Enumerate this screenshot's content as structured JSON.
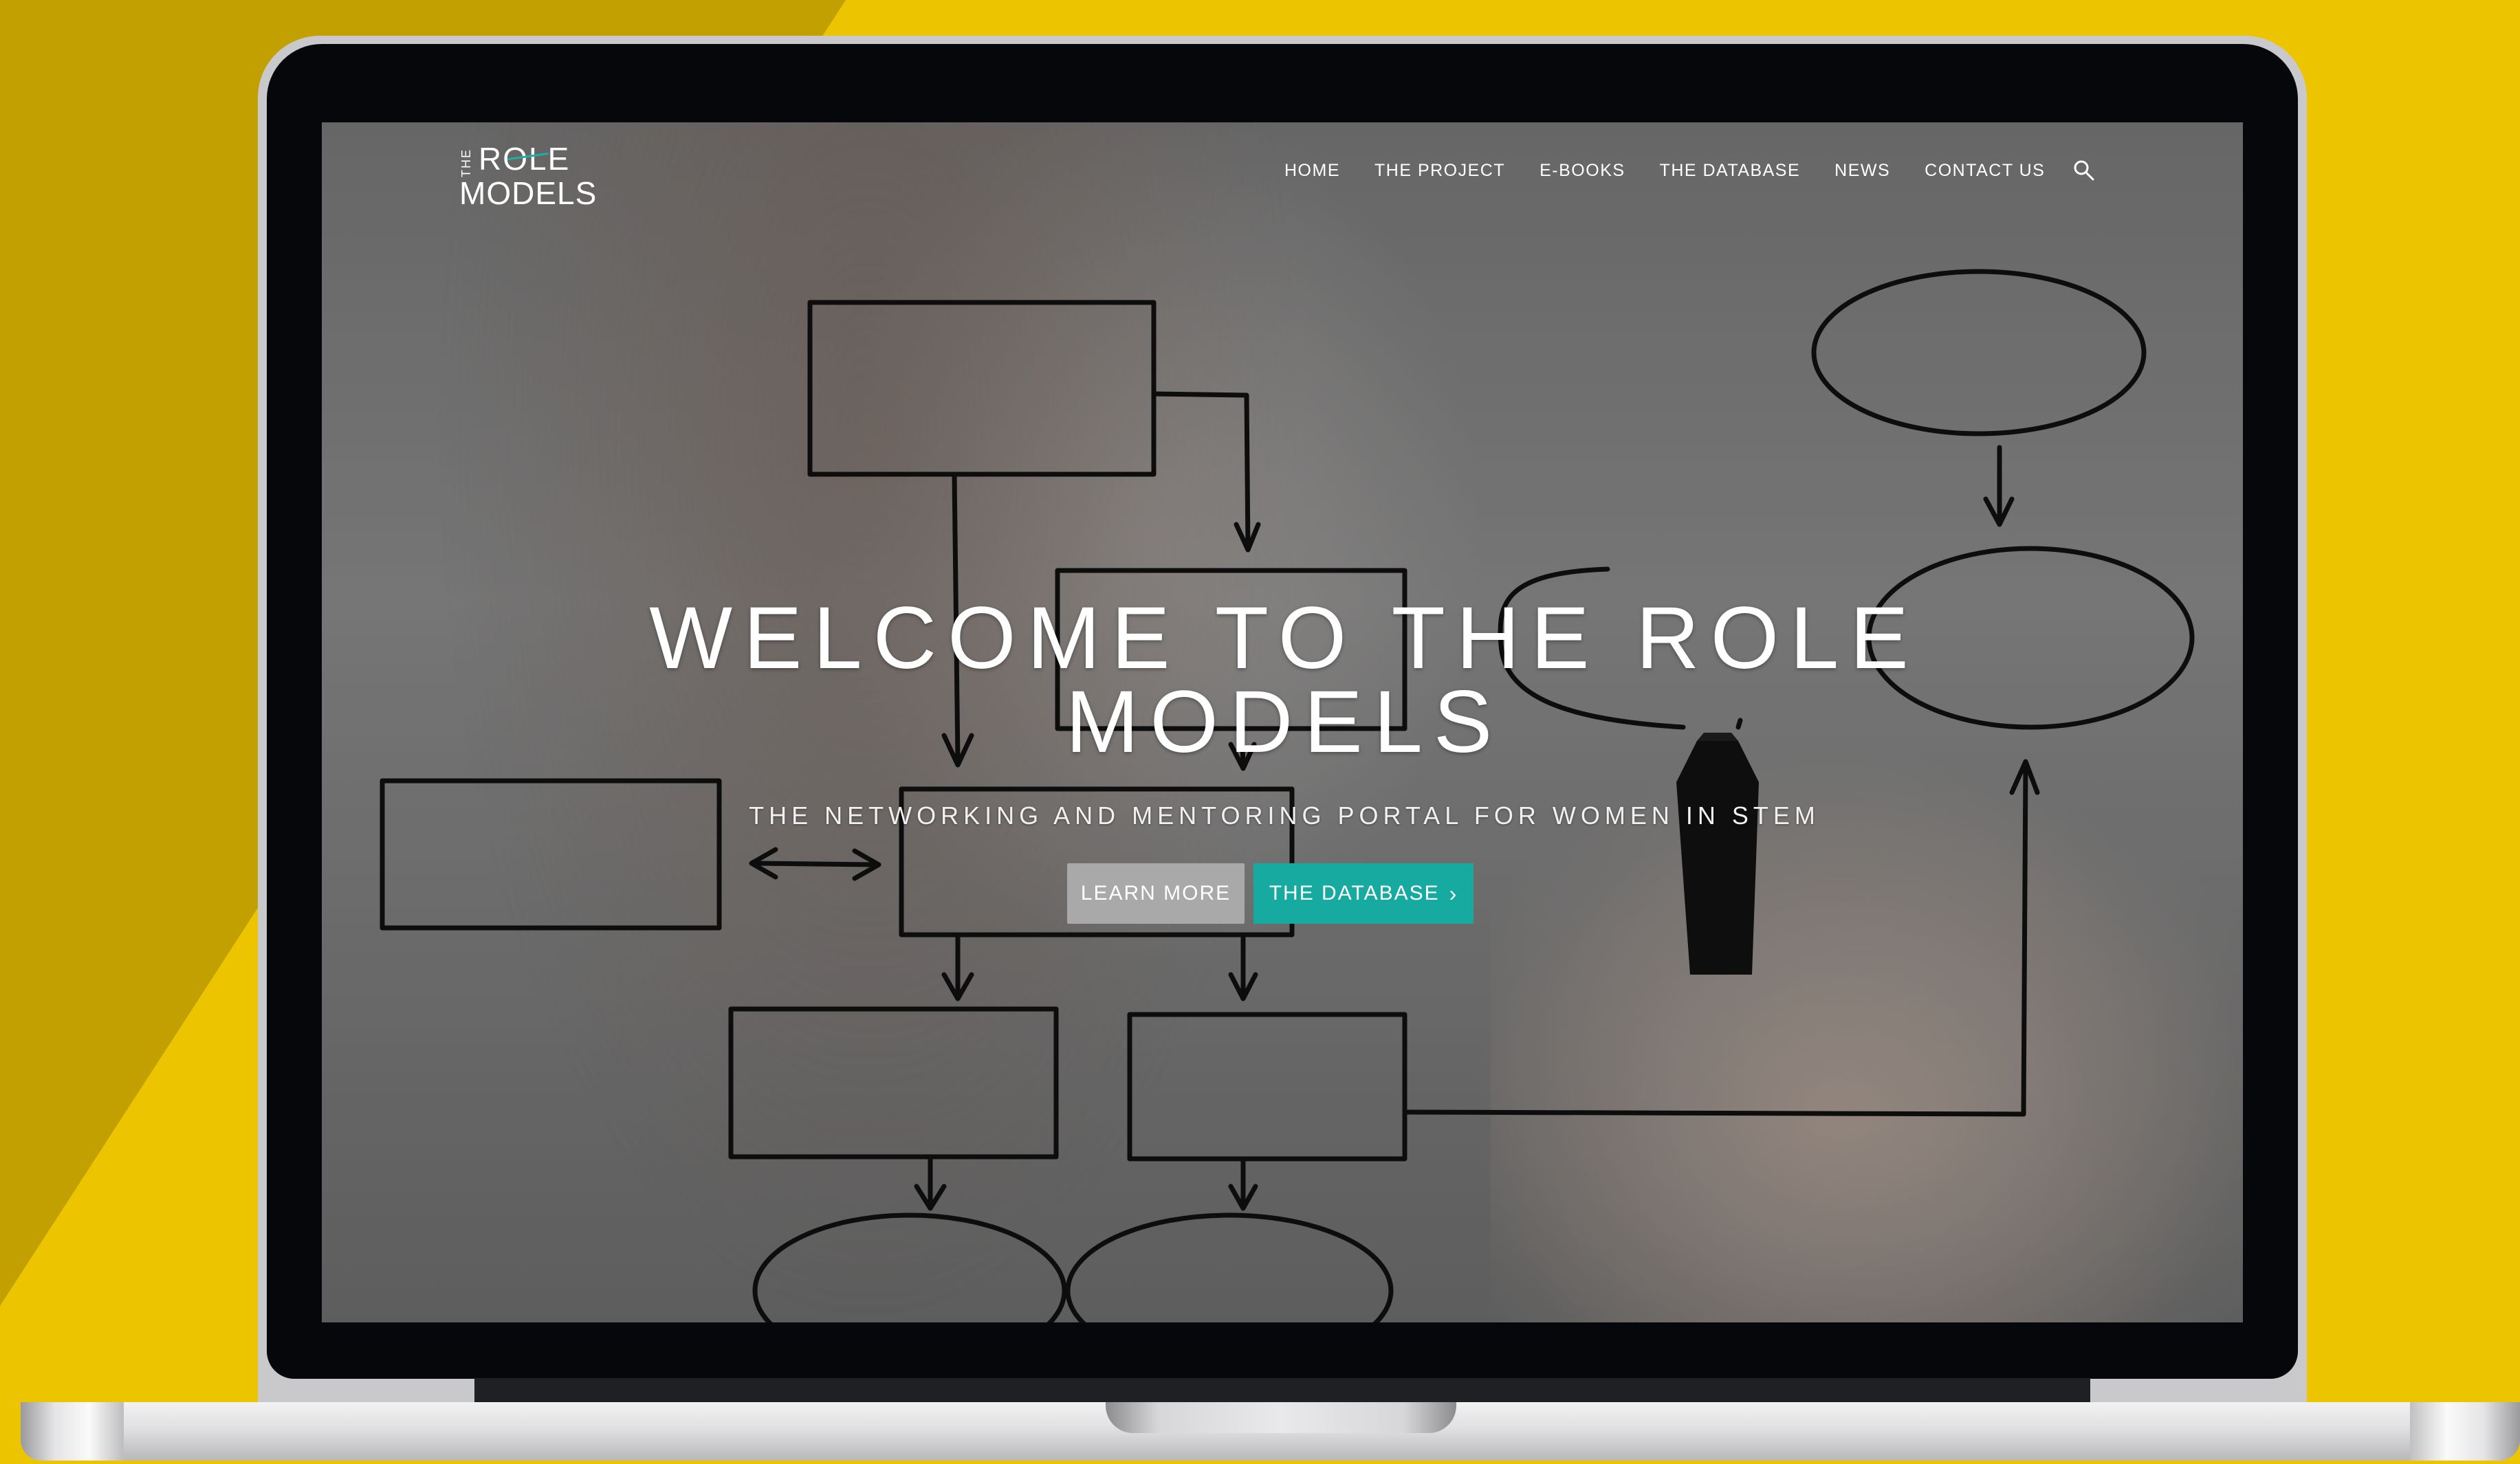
{
  "logo": {
    "the": "THE",
    "role": "ROLE",
    "models": "MODELS"
  },
  "nav": {
    "items": [
      "HOME",
      "THE PROJECT",
      "E-BOOKS",
      "THE DATABASE",
      "NEWS",
      "CONTACT US"
    ],
    "search_icon": "search-icon"
  },
  "hero": {
    "title_line1": "WELCOME TO THE ROLE",
    "title_line2": "MODELS",
    "subtitle": "THE NETWORKING AND MENTORING PORTAL FOR WOMEN IN STEM",
    "learn_more": "LEARN MORE",
    "database": "THE DATABASE",
    "database_icon": "chevron-right-icon"
  },
  "colors": {
    "accent": "#17aaa1",
    "secondary_button": "#a9a9a9",
    "background_yellow": "#ECC400"
  }
}
